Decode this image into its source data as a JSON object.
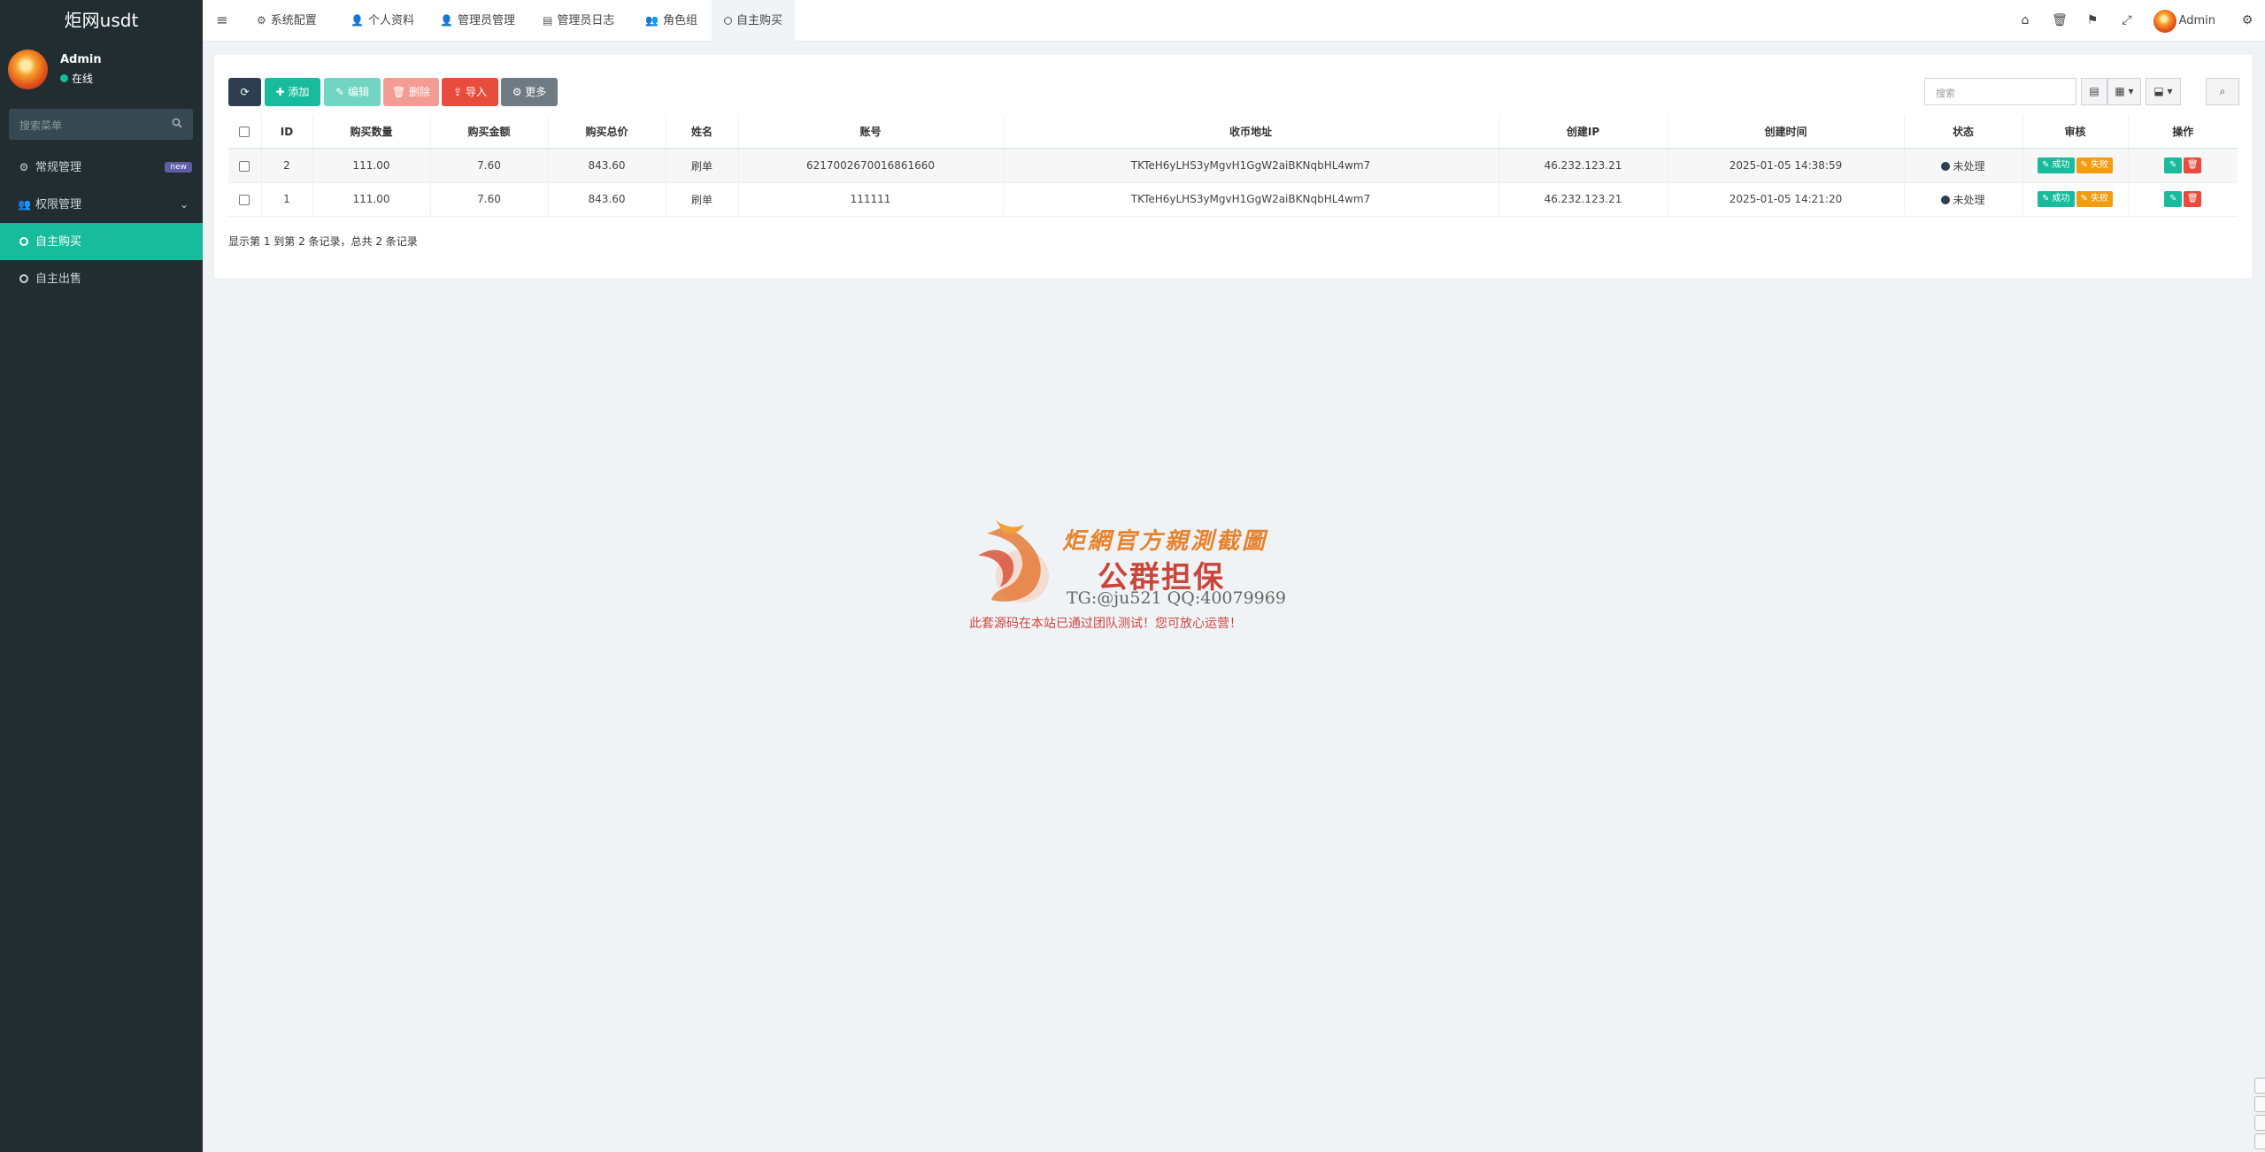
{
  "app": {
    "brand": "炬网usdt"
  },
  "user": {
    "name": "Admin",
    "status": "在线"
  },
  "sidebar": {
    "search_placeholder": "搜索菜单",
    "items": [
      {
        "label": "常规管理",
        "icon": "cogs-icon",
        "badge": "new"
      },
      {
        "label": "权限管理",
        "icon": "group-icon"
      },
      {
        "label": "自主购买",
        "icon": "circle-o-icon",
        "active": true
      },
      {
        "label": "自主出售",
        "icon": "circle-o-icon"
      }
    ]
  },
  "topnav": {
    "tabs": [
      {
        "label": "系统配置",
        "icon": "cog-icon"
      },
      {
        "label": "个人资料",
        "icon": "user-icon"
      },
      {
        "label": "管理员管理",
        "icon": "user-icon"
      },
      {
        "label": "管理员日志",
        "icon": "list-alt-icon"
      },
      {
        "label": "角色组",
        "icon": "group-icon"
      },
      {
        "label": "自主购买",
        "icon": "circle-o-icon",
        "active": true
      }
    ],
    "admin": "Admin"
  },
  "toolbar": {
    "add": "添加",
    "edit": "编辑",
    "delete": "删除",
    "import": "导入",
    "more": "更多",
    "search_placeholder": "搜索"
  },
  "table": {
    "columns": [
      "ID",
      "购买数量",
      "购买金额",
      "购买总价",
      "姓名",
      "账号",
      "收币地址",
      "创建IP",
      "创建时间",
      "状态",
      "审核",
      "操作"
    ],
    "rows": [
      {
        "id": "2",
        "qty": "111.00",
        "amount": "7.60",
        "total": "843.60",
        "name": "刷单",
        "account": "6217002670016861660",
        "address": "TKTeH6yLHS3yMgvH1GgW2aiBKNqbHL4wm7",
        "ip": "46.232.123.21",
        "time": "2025-01-05 14:38:59",
        "status": "未处理",
        "ok": "成功",
        "fail": "失败"
      },
      {
        "id": "1",
        "qty": "111.00",
        "amount": "7.60",
        "total": "843.60",
        "name": "刷单",
        "account": "111111",
        "address": "TKTeH6yLHS3yMgvH1GgW2aiBKNqbHL4wm7",
        "ip": "46.232.123.21",
        "time": "2025-01-05 14:21:20",
        "status": "未处理",
        "ok": "成功",
        "fail": "失败"
      }
    ],
    "footer": "显示第 1 到第 2 条记录，总共 2 条记录"
  },
  "watermark": {
    "line1": "炬網官方親測截圖",
    "line2": "公群担保",
    "line3": "TG:@ju521    QQ:40079969",
    "line4": "此套源码在本站已通过团队测试！您可放心运营！"
  },
  "colors": {
    "sidebar_bg": "#222d32",
    "accent": "#18bc9c",
    "danger": "#e74c3c",
    "warning": "#f39c12",
    "dark": "#2c3e50"
  }
}
